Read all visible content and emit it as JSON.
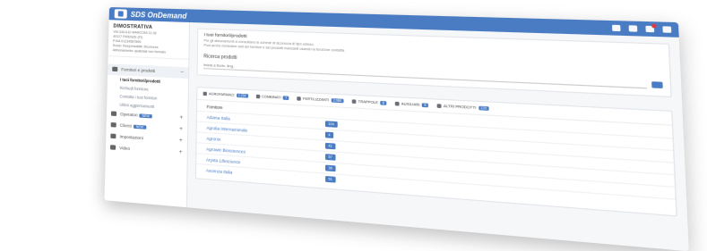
{
  "header": {
    "brand": "SDS OnDemand"
  },
  "org": {
    "name": "DIMOSTRATIVA",
    "lines": [
      "VIA GALILEI MARCONI 11 28",
      "40127 FIRENZE (FI)",
      "P.IVA 01234567890",
      "Ruolo: Responsabile Sicurezza",
      "Abbonamento: qualsiasi non formato"
    ]
  },
  "sidebar": {
    "active_group": "Fornitori e prodotti",
    "sub_items": [
      "I tuoi fornitori/prodotti",
      "Richiedi fornitore",
      "Contatta i tuoi fornitori",
      "Ultimi aggiornamenti"
    ],
    "groups": [
      {
        "label": "Operatori",
        "badge": "NEW",
        "toggle": "+"
      },
      {
        "label": "Clienti",
        "badge": "NEW",
        "toggle": "+"
      },
      {
        "label": "Impostazioni",
        "toggle": "+"
      },
      {
        "label": "Video",
        "toggle": "+"
      }
    ]
  },
  "info": {
    "title": "I tuoi fornitori/prodotti",
    "text1": "Per gli abbonamenti si consultano le schede di sicurezza di tipo esteso.",
    "text2": "Puoi anche richiedere dati dei fornitori e dei prodotti mancanti usando la funzione contatta."
  },
  "search": {
    "label": "Ricerca prodotti",
    "placeholder": "Inizia a Scriv. ling."
  },
  "categories": [
    {
      "label": "AGROFARMACI",
      "count": "1.234"
    },
    {
      "label": "COMBINATI",
      "count": "7"
    },
    {
      "label": "FERTILIZZANTI",
      "count": "2.986"
    },
    {
      "label": "TRAPPOLE",
      "count": "8"
    },
    {
      "label": "AUSILIARI",
      "count": "6"
    },
    {
      "label": "ALTRI PRODOTTI",
      "count": "129"
    }
  ],
  "table": {
    "header": "Fornitore",
    "rows": [
      {
        "supplier": "Adama Italia",
        "count": "104"
      },
      {
        "supplier": "Agrolia Internazionale",
        "count": "4"
      },
      {
        "supplier": "Agronix",
        "count": "41"
      },
      {
        "supplier": "Agrowin Biosciences",
        "count": "57"
      },
      {
        "supplier": "Arysta Lifescience",
        "count": "36"
      },
      {
        "supplier": "Ascenza Italia",
        "count": "51"
      }
    ]
  }
}
